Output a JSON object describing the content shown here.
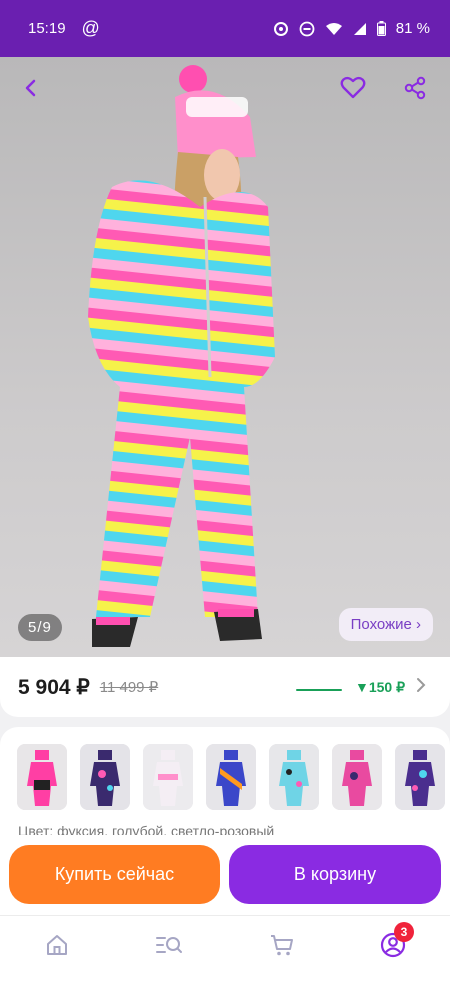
{
  "status_bar": {
    "time": "15:19",
    "at_symbol": "@",
    "battery": "81 %"
  },
  "gallery": {
    "counter": "5/9",
    "similar_label": "Похожие ›"
  },
  "price": {
    "current": "5 904 ₽",
    "old": "11 499 ₽",
    "bonus": "▼150 ₽"
  },
  "thumbnails": [
    {
      "name": "pink-black-suit"
    },
    {
      "name": "galaxy-suit"
    },
    {
      "name": "white-pink-suit"
    },
    {
      "name": "rainbow-suit"
    },
    {
      "name": "blue-print-suit"
    },
    {
      "name": "pink-camo-suit"
    },
    {
      "name": "galaxy-purple-suit"
    }
  ],
  "description_peek": "Цвет: фуксия, голубой, светло-розовый",
  "actions": {
    "buy_now": "Купить сейчас",
    "add_to_cart": "В корзину"
  },
  "bottom_nav": {
    "profile_badge": "3"
  },
  "colors": {
    "accent": "#8a2be2",
    "status_bar": "#6a1fb0",
    "buy": "#ff7c22",
    "bonus": "#19a058",
    "badge": "#f0233b"
  }
}
